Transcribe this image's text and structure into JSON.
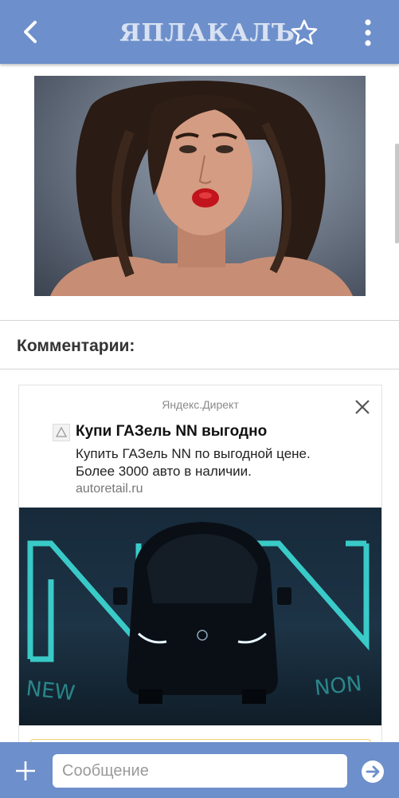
{
  "header": {
    "logo": "ЯПЛАКАЛЪ",
    "back_icon": "chevron-left-icon",
    "favorite_icon": "star-outline-icon",
    "menu_icon": "more-vertical-icon",
    "bar_color": "#6d8fcb"
  },
  "post": {
    "image_alt": "photo"
  },
  "comments": {
    "title": "Комментарии:"
  },
  "ad": {
    "source": "Яндекс.Директ",
    "title": "Купи ГАЗель NN выгодно",
    "text": "Купить ГАЗель NN по выгодной цене. Более 3000 авто в наличии.",
    "domain": "autoretail.ru",
    "banner_letters": "NN",
    "banner_strip_left": "NEW",
    "banner_strip_right": "NON",
    "neon_color": "#3fe6e0"
  },
  "composer": {
    "placeholder": "Сообщение",
    "add_icon": "plus-icon",
    "send_icon": "send-arrow-icon"
  }
}
